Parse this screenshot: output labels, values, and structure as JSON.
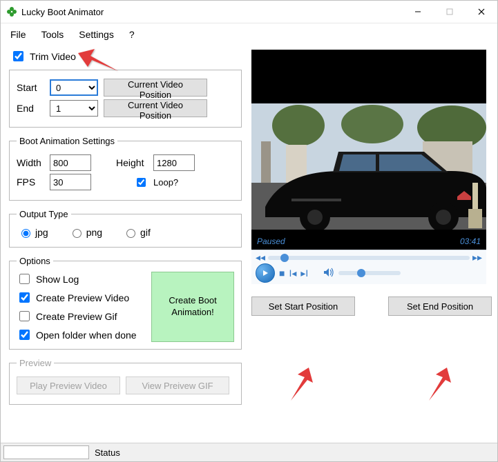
{
  "window": {
    "title": "Lucky Boot Animator"
  },
  "menu": {
    "file": "File",
    "tools": "Tools",
    "settings": "Settings",
    "help": "?"
  },
  "trim": {
    "checkbox_label": "Trim Video",
    "checked": true,
    "start_label": "Start",
    "start_value": "0",
    "start_btn": "Current Video Position",
    "end_label": "End",
    "end_value": "1",
    "end_btn": "Current Video Position"
  },
  "boot": {
    "legend": "Boot Animation Settings",
    "width_label": "Width",
    "width_value": "800",
    "height_label": "Height",
    "height_value": "1280",
    "fps_label": "FPS",
    "fps_value": "30",
    "loop_label": "Loop?",
    "loop_checked": true
  },
  "output_type": {
    "legend": "Output Type",
    "jpg": "jpg",
    "png": "png",
    "gif": "gif",
    "selected": "jpg"
  },
  "options": {
    "legend": "Options",
    "show_log": "Show Log",
    "show_log_checked": false,
    "create_preview_video": "Create Preview Video",
    "create_preview_video_checked": true,
    "create_preview_gif": "Create Preview Gif",
    "create_preview_gif_checked": false,
    "open_folder": "Open folder when done",
    "open_folder_checked": true,
    "create_btn": "Create Boot Animation!"
  },
  "preview": {
    "legend": "Preview",
    "play_video": "Play Preview Video",
    "view_gif": "View Preivew GIF"
  },
  "video": {
    "state": "Paused",
    "time": "03:41"
  },
  "right_buttons": {
    "set_start": "Set Start Position",
    "set_end": "Set End Position"
  },
  "statusbar": {
    "label": "Status"
  }
}
